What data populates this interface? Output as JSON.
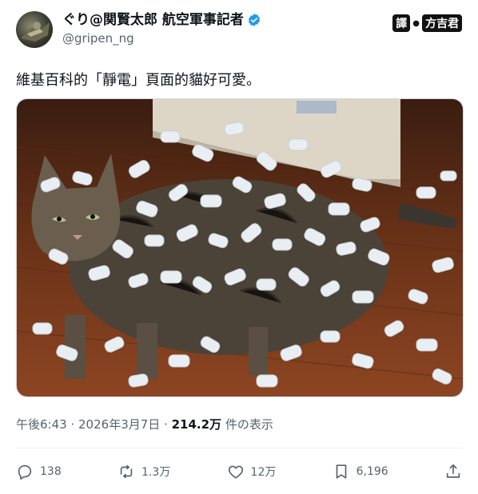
{
  "user": {
    "display_name": "ぐり@関賢太郎 航空軍事記者",
    "handle": "@gripen_ng",
    "verified": true
  },
  "badge": {
    "left": "譯",
    "right": "方吉君"
  },
  "tweet": {
    "text": "維基百科的「靜電」頁面的貓好可愛。"
  },
  "meta": {
    "time": "午後6:43",
    "date": "2026年3月7日",
    "views": "214.2万",
    "views_label": "件の表示"
  },
  "actions": {
    "replies": "138",
    "reposts": "1.3万",
    "likes": "12万",
    "bookmarks": "6,196"
  },
  "colors": {
    "verified_blue": "#1d9bf0",
    "secondary_text": "#536471"
  },
  "icons": [
    "verified-icon",
    "reply-icon",
    "repost-icon",
    "like-icon",
    "bookmark-icon",
    "share-icon"
  ]
}
